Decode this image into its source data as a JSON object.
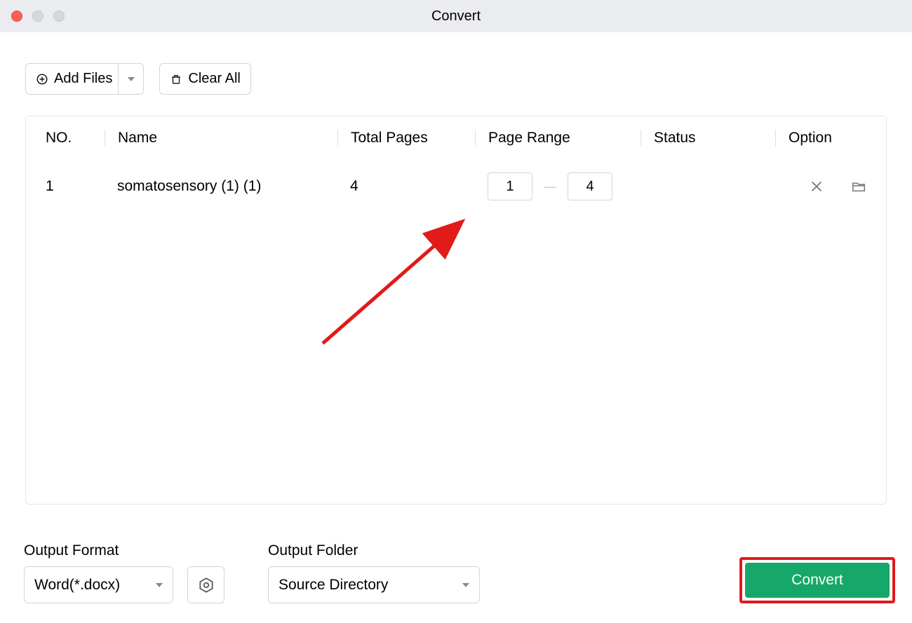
{
  "window": {
    "title": "Convert"
  },
  "toolbar": {
    "add_files_label": "Add Files",
    "clear_all_label": "Clear All"
  },
  "table": {
    "headers": {
      "no": "NO.",
      "name": "Name",
      "total_pages": "Total Pages",
      "page_range": "Page Range",
      "status": "Status",
      "option": "Option"
    },
    "rows": [
      {
        "no": "1",
        "name": "somatosensory (1) (1)",
        "total_pages": "4",
        "range_from": "1",
        "range_to": "4",
        "status": ""
      }
    ]
  },
  "output": {
    "format_label": "Output Format",
    "format_value": "Word(*.docx)",
    "folder_label": "Output Folder",
    "folder_value": "Source Directory"
  },
  "actions": {
    "convert_label": "Convert"
  },
  "colors": {
    "primary": "#15a86a",
    "highlight": "#e11a1a"
  }
}
